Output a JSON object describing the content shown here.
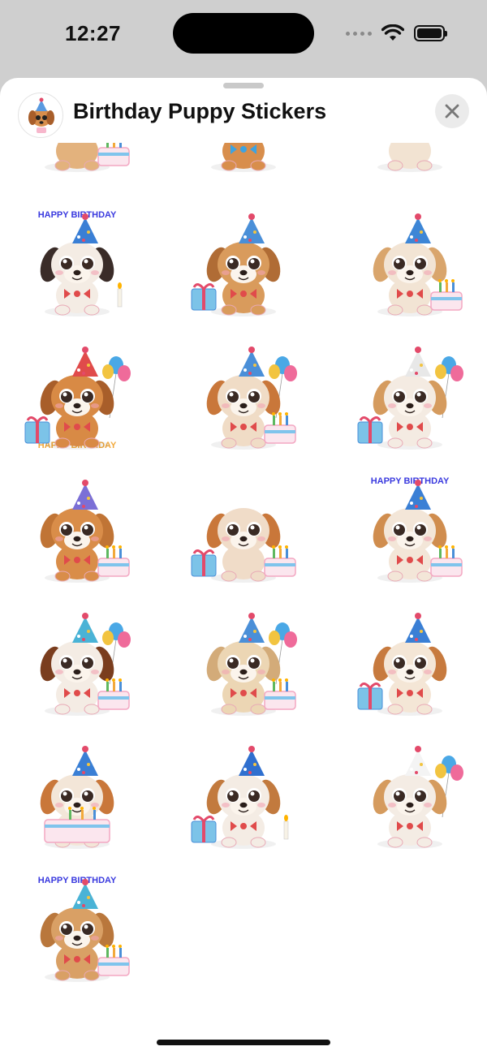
{
  "status_bar": {
    "time": "12:27",
    "battery_level": 1.0
  },
  "sheet": {
    "title": "Birthday Puppy Stickers",
    "app_icon": "puppy-sticker-app-icon",
    "close_icon": "close-icon"
  },
  "stickers": [
    {
      "id": "s1",
      "fur": "#e3b27d",
      "ear": "#9a5a2e",
      "hat": null,
      "prop": "cake-19",
      "label": "Birthday puppy sticker with cake"
    },
    {
      "id": "s2",
      "fur": "#d88e4c",
      "ear": "#b4652a",
      "hat": null,
      "prop": "bow",
      "label": "Birthday puppy sticker with bow tie"
    },
    {
      "id": "s3",
      "fur": "#f2e3d2",
      "ear": "#c88a52",
      "hat": null,
      "prop": "none",
      "label": "Birthday puppy sticker"
    },
    {
      "id": "s4",
      "fur": "#f4ece4",
      "ear": "#3a2c28",
      "hat": "#3a7fd5",
      "prop": "candle",
      "text": "HAPPY BIRTHDAY",
      "label": "Puppy with birthday headband"
    },
    {
      "id": "s5",
      "fur": "#d99b5c",
      "ear": "#b06c35",
      "hat": "#4a8fd8",
      "prop": "gift",
      "label": "Puppy with gift"
    },
    {
      "id": "s6",
      "fur": "#f2e4d4",
      "ear": "#d9a56c",
      "hat": "#3d86d6",
      "prop": "cake",
      "label": "Puppy with cake"
    },
    {
      "id": "s7",
      "fur": "#d88a45",
      "ear": "#a85e2a",
      "hat": "#e04b4b",
      "prop": "balloons-gift",
      "text": "HAPPY BIRTHDAY",
      "label": "Puppy with Happy Birthday sign"
    },
    {
      "id": "s8",
      "fur": "#f0dcc6",
      "ear": "#c9773a",
      "hat": "#4a8fd8",
      "prop": "balloons-cake",
      "label": "Puppy with balloons"
    },
    {
      "id": "s9",
      "fur": "#f4ebe2",
      "ear": "#d59b5e",
      "hat": "#e8e8e8",
      "prop": "balloons-gift",
      "label": "Puppy with gifts and balloons"
    },
    {
      "id": "s10",
      "fur": "#d98d49",
      "ear": "#c07435",
      "hat": "#7b6fd6",
      "prop": "cake",
      "label": "Puppy with pink cake"
    },
    {
      "id": "s11",
      "fur": "#f0dcc8",
      "ear": "#c9773a",
      "hat": null,
      "prop": "cake-gift",
      "label": "Puppy with cake and gift"
    },
    {
      "id": "s12",
      "fur": "#f3e6d8",
      "ear": "#d08d4e",
      "hat": "#3a7fd5",
      "prop": "cake",
      "text": "HAPPY BIRTHDAY",
      "label": "Puppy with Happy Birthday cake"
    },
    {
      "id": "s13",
      "fur": "#f4ece4",
      "ear": "#7a3d1e",
      "hat": "#4ab3d6",
      "prop": "balloons-cake",
      "label": "Puppy with party hat and cake"
    },
    {
      "id": "s14",
      "fur": "#ecd6b4",
      "ear": "#d3ab79",
      "hat": "#4a8fd8",
      "prop": "balloons-cake",
      "label": "Puppy with big cake"
    },
    {
      "id": "s15",
      "fur": "#f4e6d6",
      "ear": "#c77a3e",
      "hat": "#3a7fd5",
      "prop": "gift",
      "label": "Puppy with blue bow hat"
    },
    {
      "id": "s16",
      "fur": "#f3e6d8",
      "ear": "#c9773a",
      "hat": "#3a7fd5",
      "prop": "cake-big",
      "label": "Puppy on a cake"
    },
    {
      "id": "s17",
      "fur": "#f4ece4",
      "ear": "#c27a3e",
      "hat": "#2f6fcf",
      "prop": "gift-candle",
      "label": "Puppy with gift and candle"
    },
    {
      "id": "s18",
      "fur": "#f4ece4",
      "ear": "#d59b5e",
      "hat": "#f4f4f4",
      "prop": "balloons",
      "label": "Puppy with polka-dot hat"
    },
    {
      "id": "s19",
      "fur": "#d9a065",
      "ear": "#b9773c",
      "hat": "#4ab3d6",
      "prop": "cake",
      "text": "HAPPY BIRTHDAY",
      "label": "Puppy with Happy Birthday banner"
    }
  ]
}
